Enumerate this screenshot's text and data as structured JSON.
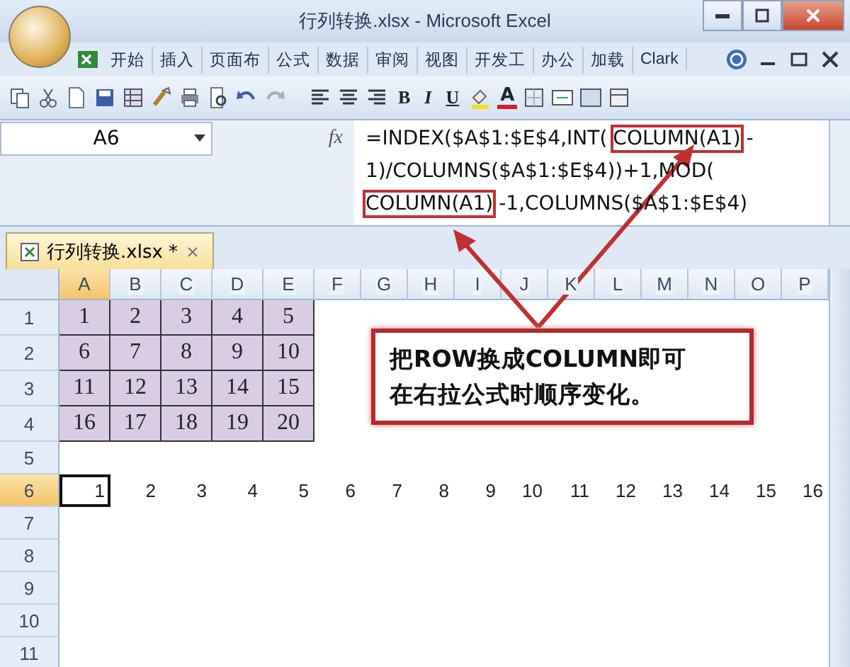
{
  "window": {
    "title": "行列转换.xlsx - Microsoft Excel"
  },
  "ribbon_tabs": [
    "开始",
    "插入",
    "页面布",
    "公式",
    "数据",
    "审阅",
    "视图",
    "开发工",
    "办公",
    "加载",
    "Clark"
  ],
  "toolbar": {
    "format_buttons": [
      "B",
      "I",
      "U"
    ],
    "font_color_button": "A"
  },
  "formula_bar": {
    "name_box": "A6",
    "fx_label": "fx",
    "lines": [
      [
        {
          "text": "=INDEX($A$1:$E$4,INT(",
          "highlighted": false
        },
        {
          "text": "COLUMN(A1)",
          "highlighted": true
        },
        {
          "text": "-",
          "highlighted": false
        }
      ],
      [
        {
          "text": "1)/COLUMNS($A$1:$E$4))+1,MOD(",
          "highlighted": false
        }
      ],
      [
        {
          "text": "COLUMN(A1)",
          "highlighted": true
        },
        {
          "text": "-1,COLUMNS($A$1:$E$4)",
          "highlighted": false
        }
      ]
    ]
  },
  "workbook_tab": {
    "title": "行列转换.xlsx *"
  },
  "columns": [
    {
      "label": "A",
      "selected": true
    },
    {
      "label": "B",
      "selected": false
    },
    {
      "label": "C",
      "selected": false
    },
    {
      "label": "D",
      "selected": false
    },
    {
      "label": "E",
      "selected": false
    },
    {
      "label": "F",
      "selected": false
    },
    {
      "label": "G",
      "selected": false
    },
    {
      "label": "H",
      "selected": false
    },
    {
      "label": "I",
      "selected": false
    },
    {
      "label": "J",
      "selected": false
    },
    {
      "label": "K",
      "selected": false
    },
    {
      "label": "L",
      "selected": false
    },
    {
      "label": "M",
      "selected": false
    },
    {
      "label": "N",
      "selected": false
    },
    {
      "label": "O",
      "selected": false
    },
    {
      "label": "P",
      "selected": false
    }
  ],
  "rows": [
    {
      "label": "1",
      "selected": false,
      "cells": [
        {
          "value": "1",
          "selected": false,
          "shaded": true
        },
        {
          "value": "2",
          "selected": false,
          "shaded": true
        },
        {
          "value": "3",
          "selected": false,
          "shaded": true
        },
        {
          "value": "4",
          "selected": false,
          "shaded": true
        },
        {
          "value": "5",
          "selected": false,
          "shaded": true
        }
      ]
    },
    {
      "label": "2",
      "selected": false,
      "cells": [
        {
          "value": "6",
          "selected": false,
          "shaded": true
        },
        {
          "value": "7",
          "selected": false,
          "shaded": true
        },
        {
          "value": "8",
          "selected": false,
          "shaded": true
        },
        {
          "value": "9",
          "selected": false,
          "shaded": true
        },
        {
          "value": "10",
          "selected": false,
          "shaded": true
        }
      ]
    },
    {
      "label": "3",
      "selected": false,
      "cells": [
        {
          "value": "11",
          "selected": false,
          "shaded": true
        },
        {
          "value": "12",
          "selected": false,
          "shaded": true
        },
        {
          "value": "13",
          "selected": false,
          "shaded": true
        },
        {
          "value": "14",
          "selected": false,
          "shaded": true
        },
        {
          "value": "15",
          "selected": false,
          "shaded": true
        }
      ]
    },
    {
      "label": "4",
      "selected": false,
      "cells": [
        {
          "value": "16",
          "selected": false,
          "shaded": true
        },
        {
          "value": "17",
          "selected": false,
          "shaded": true
        },
        {
          "value": "18",
          "selected": false,
          "shaded": true
        },
        {
          "value": "19",
          "selected": false,
          "shaded": true
        },
        {
          "value": "20",
          "selected": false,
          "shaded": true
        }
      ]
    },
    {
      "label": "5",
      "selected": false
    },
    {
      "label": "6",
      "selected": true,
      "cells": [
        {
          "value": "1",
          "selected": true,
          "shaded": false
        },
        {
          "value": "2",
          "selected": false,
          "shaded": false
        },
        {
          "value": "3",
          "selected": false,
          "shaded": false
        },
        {
          "value": "4",
          "selected": false,
          "shaded": false
        },
        {
          "value": "5",
          "selected": false,
          "shaded": false
        },
        {
          "value": "6",
          "selected": false,
          "shaded": false
        },
        {
          "value": "7",
          "selected": false,
          "shaded": false
        },
        {
          "value": "8",
          "selected": false,
          "shaded": false
        },
        {
          "value": "9",
          "selected": false,
          "shaded": false
        },
        {
          "value": "10",
          "selected": false,
          "shaded": false
        },
        {
          "value": "11",
          "selected": false,
          "shaded": false
        },
        {
          "value": "12",
          "selected": false,
          "shaded": false
        },
        {
          "value": "13",
          "selected": false,
          "shaded": false
        },
        {
          "value": "14",
          "selected": false,
          "shaded": false
        },
        {
          "value": "15",
          "selected": false,
          "shaded": false
        },
        {
          "value": "16",
          "selected": false,
          "shaded": false
        }
      ]
    },
    {
      "label": "7",
      "selected": false
    },
    {
      "label": "8",
      "selected": false
    },
    {
      "label": "9",
      "selected": false
    },
    {
      "label": "10",
      "selected": false
    },
    {
      "label": "11",
      "selected": false
    }
  ],
  "callout": {
    "lines": [
      "把ROW换成COLUMN即可",
      "在右拉公式时顺序变化。"
    ]
  }
}
